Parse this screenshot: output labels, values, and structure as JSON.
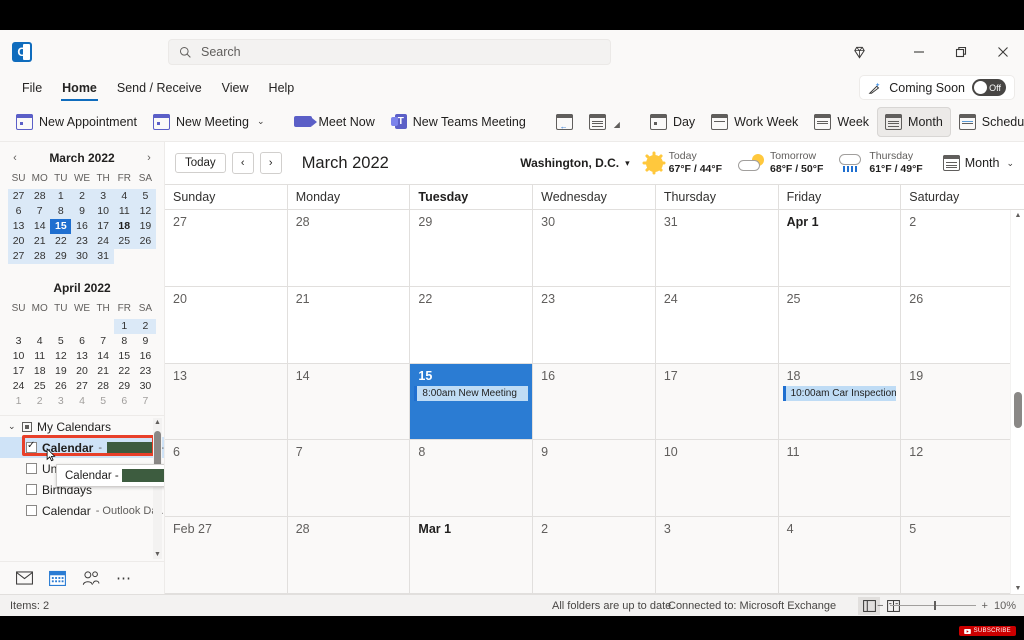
{
  "titlebar": {
    "app_icon": "outlook-icon",
    "search_placeholder": "Search",
    "diamond_icon": "diamond-icon",
    "minimize": "—",
    "restore": "❐",
    "close": "✕"
  },
  "menubar": {
    "items": [
      "File",
      "Home",
      "Send / Receive",
      "View",
      "Help"
    ],
    "active": "Home",
    "coming_soon_label": "Coming Soon",
    "toggle_state": "Off"
  },
  "ribbon": {
    "buttons": [
      {
        "label": "New Appointment",
        "icon": "calendar-new-icon"
      },
      {
        "label": "New Meeting",
        "icon": "calendar-meeting-icon",
        "caret": "⌄"
      },
      {
        "label": "Meet Now",
        "icon": "camera-icon"
      },
      {
        "label": "New Teams Meeting",
        "icon": "teams-icon"
      },
      {
        "label": "Day",
        "icon": "day-view-icon"
      },
      {
        "label": "Work Week",
        "icon": "work-week-icon"
      },
      {
        "label": "Week",
        "icon": "week-view-icon"
      },
      {
        "label": "Month",
        "icon": "month-view-icon"
      },
      {
        "label": "Schedule View",
        "icon": "schedule-view-icon"
      }
    ],
    "selected_view": "Month",
    "overflow": "⋯",
    "collapse": "⌄"
  },
  "mini_calendars": [
    {
      "title": "March 2022",
      "prev": "‹",
      "next": "›",
      "dow": [
        "SU",
        "MO",
        "TU",
        "WE",
        "TH",
        "FR",
        "SA"
      ],
      "weeks": [
        [
          {
            "d": "27",
            "hl": true
          },
          {
            "d": "28",
            "hl": true
          },
          {
            "d": "1",
            "hl": true
          },
          {
            "d": "2",
            "hl": true
          },
          {
            "d": "3",
            "hl": true
          },
          {
            "d": "4",
            "hl": true
          },
          {
            "d": "5",
            "hl": true
          }
        ],
        [
          {
            "d": "6",
            "hl": true
          },
          {
            "d": "7",
            "hl": true
          },
          {
            "d": "8",
            "hl": true
          },
          {
            "d": "9",
            "hl": true
          },
          {
            "d": "10",
            "hl": true
          },
          {
            "d": "11",
            "hl": true
          },
          {
            "d": "12",
            "hl": true
          }
        ],
        [
          {
            "d": "13",
            "hl": true
          },
          {
            "d": "14",
            "hl": true
          },
          {
            "d": "15",
            "sel": true
          },
          {
            "d": "16",
            "hl": true
          },
          {
            "d": "17",
            "hl": true
          },
          {
            "d": "18",
            "hl": true,
            "bold": true
          },
          {
            "d": "19",
            "hl": true
          }
        ],
        [
          {
            "d": "20",
            "hl": true
          },
          {
            "d": "21",
            "hl": true
          },
          {
            "d": "22",
            "hl": true
          },
          {
            "d": "23",
            "hl": true
          },
          {
            "d": "24",
            "hl": true
          },
          {
            "d": "25",
            "hl": true
          },
          {
            "d": "26",
            "hl": true
          }
        ],
        [
          {
            "d": "27",
            "hl": true
          },
          {
            "d": "28",
            "hl": true
          },
          {
            "d": "29",
            "hl": true
          },
          {
            "d": "30",
            "hl": true
          },
          {
            "d": "31",
            "hl": true
          },
          {
            "d": "",
            "hl": false
          },
          {
            "d": "",
            "hl": false
          }
        ]
      ]
    },
    {
      "title": "April 2022",
      "prev": "",
      "next": "",
      "dow": [
        "SU",
        "MO",
        "TU",
        "WE",
        "TH",
        "FR",
        "SA"
      ],
      "weeks": [
        [
          {
            "d": ""
          },
          {
            "d": ""
          },
          {
            "d": ""
          },
          {
            "d": ""
          },
          {
            "d": ""
          },
          {
            "d": "1",
            "hl": true
          },
          {
            "d": "2",
            "hl": true
          }
        ],
        [
          {
            "d": "3"
          },
          {
            "d": "4"
          },
          {
            "d": "5"
          },
          {
            "d": "6"
          },
          {
            "d": "7"
          },
          {
            "d": "8"
          },
          {
            "d": "9"
          }
        ],
        [
          {
            "d": "10"
          },
          {
            "d": "11"
          },
          {
            "d": "12"
          },
          {
            "d": "13"
          },
          {
            "d": "14"
          },
          {
            "d": "15"
          },
          {
            "d": "16"
          }
        ],
        [
          {
            "d": "17"
          },
          {
            "d": "18"
          },
          {
            "d": "19"
          },
          {
            "d": "20"
          },
          {
            "d": "21"
          },
          {
            "d": "22"
          },
          {
            "d": "23"
          }
        ],
        [
          {
            "d": "24"
          },
          {
            "d": "25"
          },
          {
            "d": "26"
          },
          {
            "d": "27"
          },
          {
            "d": "28"
          },
          {
            "d": "29"
          },
          {
            "d": "30"
          }
        ],
        [
          {
            "d": "1",
            "dim": true
          },
          {
            "d": "2",
            "dim": true
          },
          {
            "d": "3",
            "dim": true
          },
          {
            "d": "4",
            "dim": true
          },
          {
            "d": "5",
            "dim": true
          },
          {
            "d": "6",
            "dim": true
          },
          {
            "d": "7",
            "dim": true
          }
        ]
      ]
    }
  ],
  "folder_pane": {
    "group_label": "My Calendars",
    "group_chevron": "⌄",
    "items": [
      {
        "label": "Calendar",
        "suffix": "-",
        "redacted": true,
        "checked": true,
        "selected": true,
        "bold": true
      },
      {
        "label": "Unit",
        "checked": false
      },
      {
        "label": "Birthdays",
        "checked": false
      },
      {
        "label": "Calendar",
        "suffix": "- Outlook Da...",
        "checked": false
      }
    ],
    "tooltip": {
      "text": "Calendar -",
      "redacted": true
    },
    "scroll_up": "▲",
    "scroll_down": "▼"
  },
  "module_nav": [
    {
      "name": "mail",
      "icon": "envelope-icon",
      "active": false
    },
    {
      "name": "calendar",
      "icon": "calendar-icon",
      "active": true
    },
    {
      "name": "people",
      "icon": "people-icon",
      "active": false
    },
    {
      "name": "more",
      "icon": "ellipsis-icon",
      "active": false
    }
  ],
  "calendar_toolbar": {
    "today_label": "Today",
    "prev": "‹",
    "next": "›",
    "title": "March 2022",
    "location": "Washington, D.C.",
    "location_caret": "▾",
    "weather": [
      {
        "day": "Today",
        "temp": "67°F / 44°F",
        "icon": "sun-icon"
      },
      {
        "day": "Tomorrow",
        "temp": "68°F / 50°F",
        "icon": "sun-behind-cloud-icon"
      },
      {
        "day": "Thursday",
        "temp": "61°F / 49°F",
        "icon": "rain-cloud-icon"
      }
    ],
    "view_label": "Month",
    "view_caret": "⌄",
    "view_icon": "month-view-icon"
  },
  "calendar_grid": {
    "day_headers": [
      "Sunday",
      "Monday",
      "Tuesday",
      "Wednesday",
      "Thursday",
      "Friday",
      "Saturday"
    ],
    "today_column": "Tuesday",
    "weeks": [
      {
        "shaded": true,
        "days": [
          {
            "num": "Feb 27"
          },
          {
            "num": "28"
          },
          {
            "num": "Mar 1",
            "bold": true
          },
          {
            "num": "2"
          },
          {
            "num": "3"
          },
          {
            "num": "4"
          },
          {
            "num": "5"
          }
        ]
      },
      {
        "shaded": true,
        "days": [
          {
            "num": "6"
          },
          {
            "num": "7"
          },
          {
            "num": "8"
          },
          {
            "num": "9"
          },
          {
            "num": "10"
          },
          {
            "num": "11"
          },
          {
            "num": "12"
          }
        ]
      },
      {
        "shaded": true,
        "days": [
          {
            "num": "13"
          },
          {
            "num": "14"
          },
          {
            "num": "15",
            "selected": true,
            "events": [
              {
                "time": "8:00am",
                "title": "New Meeting"
              }
            ]
          },
          {
            "num": "16"
          },
          {
            "num": "17"
          },
          {
            "num": "18",
            "events": [
              {
                "time": "10:00am",
                "title": "Car Inspection"
              }
            ]
          },
          {
            "num": "19"
          }
        ]
      },
      {
        "shaded": false,
        "days": [
          {
            "num": "20"
          },
          {
            "num": "21"
          },
          {
            "num": "22"
          },
          {
            "num": "23"
          },
          {
            "num": "24"
          },
          {
            "num": "25"
          },
          {
            "num": "26"
          }
        ]
      },
      {
        "shaded": false,
        "days": [
          {
            "num": "27"
          },
          {
            "num": "28"
          },
          {
            "num": "29"
          },
          {
            "num": "30"
          },
          {
            "num": "31"
          },
          {
            "num": "Apr 1",
            "bold": true
          },
          {
            "num": "2"
          }
        ]
      }
    ],
    "scroll_up": "▲",
    "scroll_down": "▼"
  },
  "status_bar": {
    "items_count": "Items: 2",
    "folders_status": "All folders are up to date.",
    "connection": "Connected to: Microsoft Exchange",
    "zoom_level": "10%",
    "zoom_out": "−",
    "zoom_in": "+",
    "normal_view_icon": "normal-view-icon",
    "reading_view_icon": "reading-view-icon"
  },
  "watermark": {
    "label": "SUBSCRIBE"
  },
  "colors": {
    "accent": "#0f6cbd",
    "selected_day": "#2b7cd3",
    "event_fill": "#bfdcf5",
    "event_bar": "#1f6fd0",
    "highlight_box": "#e8402a",
    "redaction": "#3d5c3f"
  }
}
